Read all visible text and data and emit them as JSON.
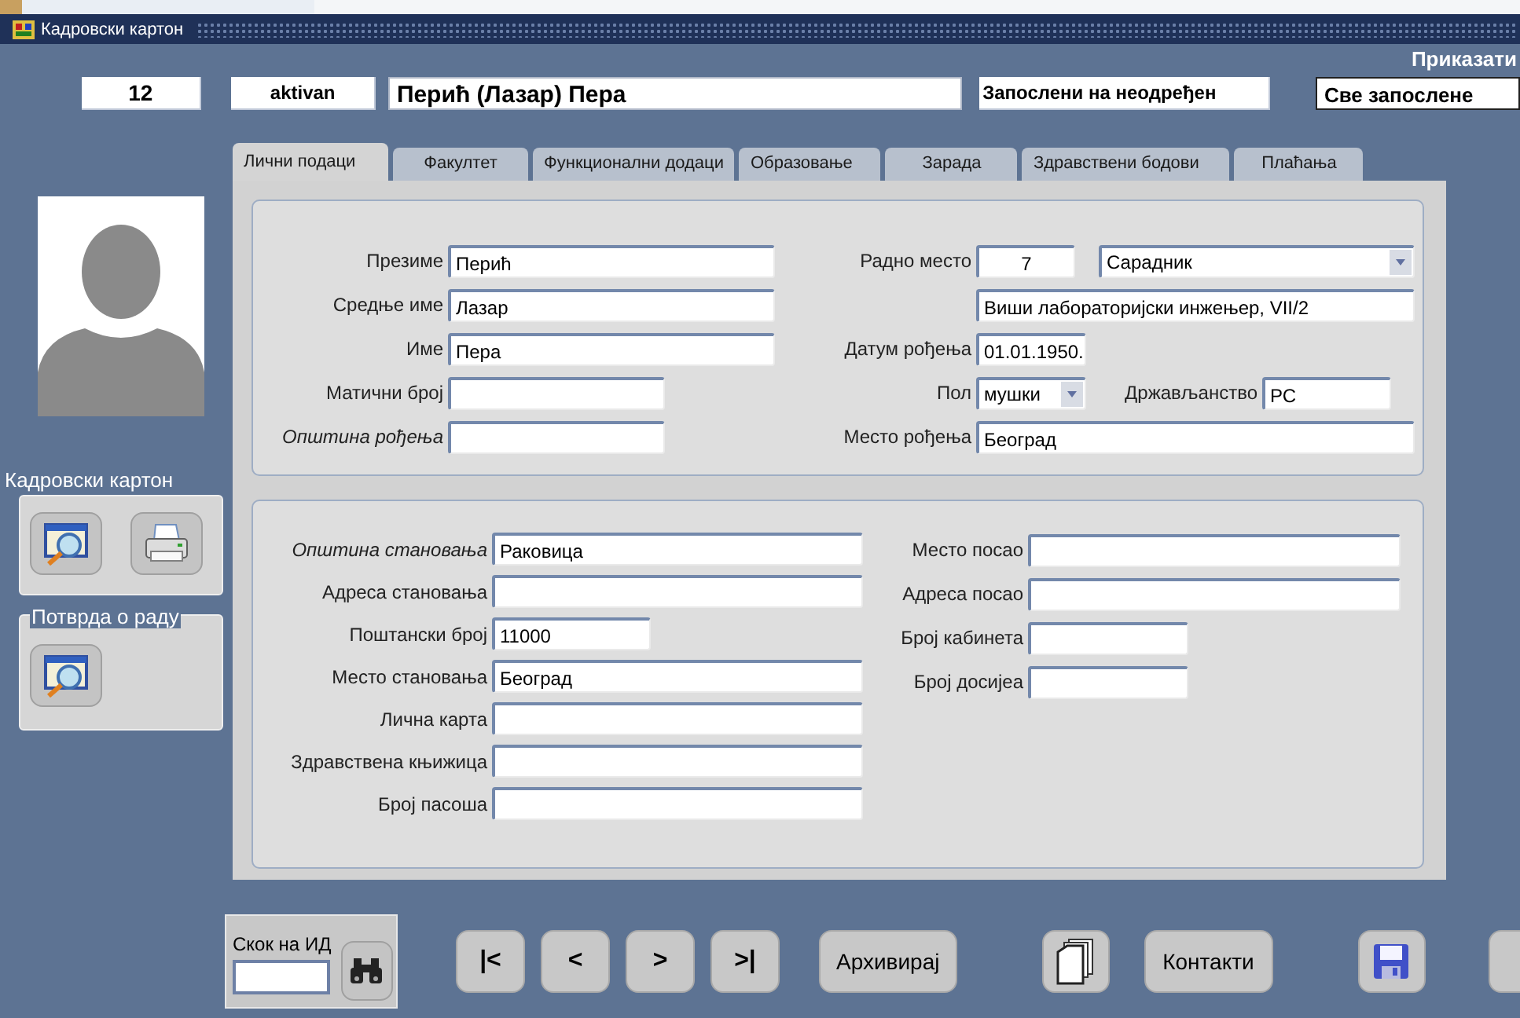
{
  "window": {
    "title": "Кадровски картон"
  },
  "header": {
    "show_label": "Приказати",
    "id": "12",
    "status": "aktivan",
    "full_name": "Перић (Лазар) Пера",
    "employment": "Запослени на неодређен",
    "filter": "Све запослене"
  },
  "tabs": [
    {
      "label": "Лични подаци",
      "selected": true
    },
    {
      "label": "Факултет",
      "selected": false
    },
    {
      "label": "Функционални додаци",
      "selected": false
    },
    {
      "label": "Образовање",
      "selected": false
    },
    {
      "label": "Зарада",
      "selected": false
    },
    {
      "label": "Здравствени бодови",
      "selected": false
    },
    {
      "label": "Плаћања",
      "selected": false
    }
  ],
  "personal": {
    "left": [
      {
        "label": "Презиме",
        "value": "Перић",
        "italic": false
      },
      {
        "label": "Средње име",
        "value": "Лазар",
        "italic": false
      },
      {
        "label": "Име",
        "value": "Пера",
        "italic": false
      },
      {
        "label": "Матични број",
        "italic": false
      },
      {
        "label": "Општина рођења",
        "italic": true
      }
    ],
    "right": [
      {
        "items": [
          {
            "kind": "label",
            "text": "Радно место"
          },
          {
            "kind": "number",
            "text": "7"
          },
          {
            "kind": "select",
            "text": "Сарадник"
          }
        ]
      },
      {
        "items": [
          {
            "kind": "text",
            "text": "Виши лабораторијски инжењер, VII/2"
          }
        ]
      },
      {
        "items": [
          {
            "kind": "label",
            "text": "Датум рођења"
          },
          {
            "kind": "text",
            "text": "01.01.1950."
          }
        ]
      },
      {
        "items": [
          {
            "kind": "label",
            "text": "Пол"
          },
          {
            "kind": "select",
            "text": "мушки"
          },
          {
            "kind": "label",
            "text": "Држављанство"
          },
          {
            "kind": "text",
            "text": "РС"
          }
        ]
      },
      {
        "items": [
          {
            "kind": "label",
            "text": "Место рођења"
          },
          {
            "kind": "text",
            "text": "Београд"
          }
        ]
      }
    ]
  },
  "address": {
    "left": [
      {
        "label": "Општина становања",
        "value": "Раковица",
        "italic": true
      },
      {
        "label": "Адреса становања",
        "italic": false
      },
      {
        "label": "Поштански број",
        "value": "11000",
        "italic": false
      },
      {
        "label": "Место становања",
        "value": "Београд",
        "italic": false
      },
      {
        "label": "Лична карта",
        "italic": false
      },
      {
        "label": "Здравствена књижица",
        "italic": false
      },
      {
        "label": "Број пасоша",
        "italic": false
      }
    ],
    "right": [
      {
        "label": "Место посао",
        "italic": false
      },
      {
        "label": "Адреса посао",
        "italic": false
      },
      {
        "label": "Број кабинета",
        "italic": false
      },
      {
        "label": "Број досијеа",
        "italic": false
      }
    ]
  },
  "sidebar": {
    "groups": [
      {
        "title": "Кадровски картон",
        "buttons": [
          {
            "kind": "preview"
          },
          {
            "kind": "print"
          }
        ]
      },
      {
        "title": "Потврда о раду",
        "buttons": [
          {
            "kind": "preview"
          }
        ]
      }
    ]
  },
  "footer": {
    "jump_label": "Скок на ИД",
    "buttons": [
      {
        "kind": "nav",
        "text": "|<"
      },
      {
        "kind": "nav",
        "text": "<"
      },
      {
        "kind": "nav",
        "text": ">"
      },
      {
        "kind": "nav",
        "text": ">|"
      },
      {
        "kind": "text",
        "text": "Архивирај"
      },
      {
        "kind": "copy"
      },
      {
        "kind": "text",
        "text": "Контакти"
      },
      {
        "kind": "save"
      },
      {
        "kind": "edge"
      }
    ]
  }
}
